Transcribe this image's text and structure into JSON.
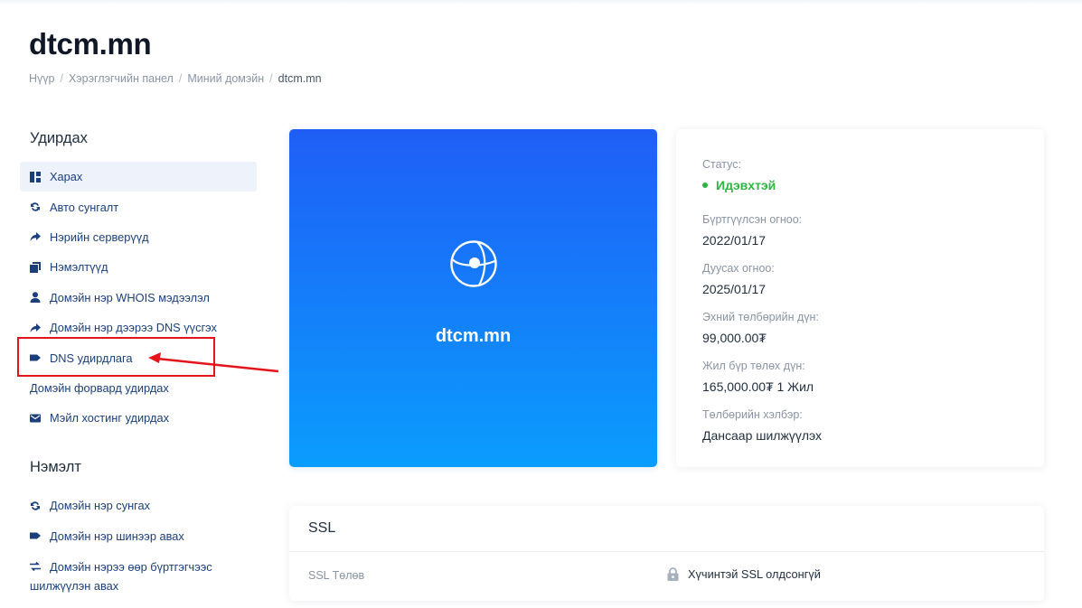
{
  "page": {
    "title": "dtcm.mn"
  },
  "breadcrumb": [
    {
      "label": "Нүүр"
    },
    {
      "label": "Хэрэглэгчийн панел"
    },
    {
      "label": "Миний домэйн"
    },
    {
      "label": "dtcm.mn"
    }
  ],
  "sidebar": {
    "manage_heading": "Удирдах",
    "manage_items": [
      {
        "label": "Харах",
        "icon": "dashboard-icon",
        "active": true
      },
      {
        "label": "Авто сунгалт",
        "icon": "refresh-icon"
      },
      {
        "label": "Нэрийн серверүүд",
        "icon": "share-arrow-icon"
      },
      {
        "label": "Нэмэлтүүд",
        "icon": "addons-icon"
      },
      {
        "label": "Домэйн нэр WHOIS мэдээлэл",
        "icon": "user-icon"
      },
      {
        "label": "Домэйн нэр дээрээ DNS үүсгэх",
        "icon": "share-arrow-icon"
      },
      {
        "label": "DNS удирдлага",
        "icon": "tag-icon"
      },
      {
        "label": "Домэйн форвард удирдах",
        "icon": ""
      },
      {
        "label": "Мэйл хостинг удирдах",
        "icon": "mail-icon"
      }
    ],
    "extra_heading": "Нэмэлт",
    "extra_items": [
      {
        "label": "Домэйн нэр сунгах",
        "icon": "refresh-icon"
      },
      {
        "label": "Домэйн нэр шинээр авах",
        "icon": "tag-icon"
      },
      {
        "label": "Домэйн нэрээ өөр бүртгэгчээс шилжүүлэн авах",
        "icon": "transfer-icon"
      }
    ]
  },
  "hero": {
    "domain": "dtcm.mn",
    "icon": "globe-icon"
  },
  "info": {
    "status_label": "Статус:",
    "status_value": "Идэвхтэй",
    "registered_label": "Бүртгүүлсэн огноо:",
    "registered_value": "2022/01/17",
    "expires_label": "Дуусах огноо:",
    "expires_value": "2025/01/17",
    "first_payment_label": "Эхний төлбөрийн дүн:",
    "first_payment_value": "99,000.00₮",
    "annual_label": "Жил бүр төлөх дүн:",
    "annual_value": "165,000.00₮ 1 Жил",
    "method_label": "Төлбөрийн хэлбэр:",
    "method_value": "Дансаар шилжүүлэх"
  },
  "ssl": {
    "title": "SSL",
    "status_label": "SSL Төлөв",
    "status_value": "Хүчинтэй SSL олдсонгүй",
    "icon": "lock-icon"
  },
  "colors": {
    "accent_blue": "#1f5ef6",
    "nav_text": "#1b3f7a",
    "status_green": "#2fb344",
    "annotation_red": "#e3151a"
  }
}
